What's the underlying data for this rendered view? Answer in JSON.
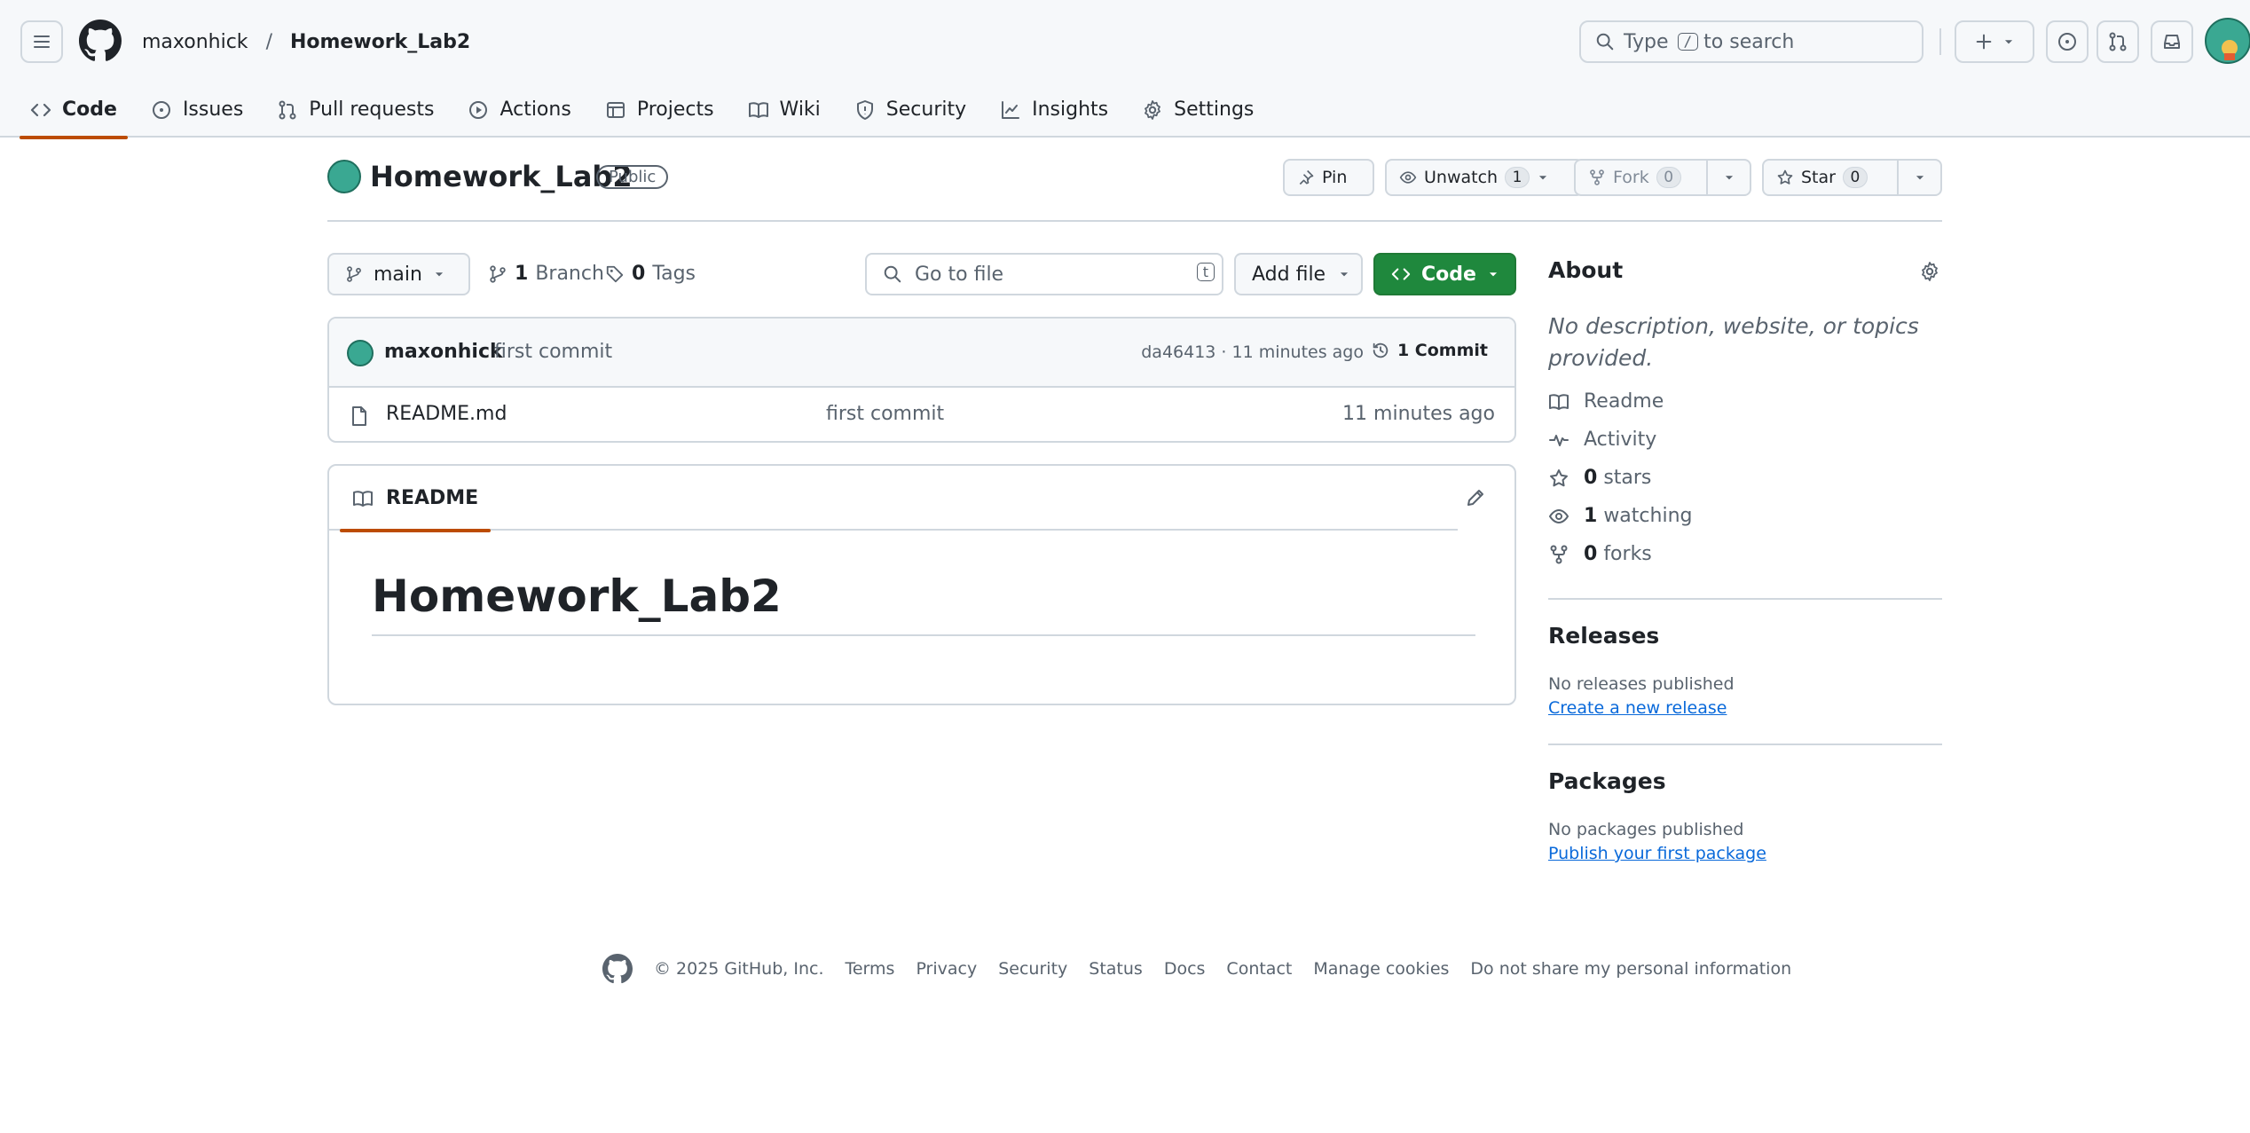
{
  "colors": {
    "accent": "#bc4c00",
    "primary_green": "#1f883d",
    "link": "#0969da",
    "border": "#d0d7de",
    "muted": "#59636e"
  },
  "header": {
    "owner": "maxonhick",
    "separator": "/",
    "repo": "Homework_Lab2",
    "search": {
      "prefix": "Type",
      "key": "/",
      "suffix": "to search"
    },
    "icons": [
      "hamburger-icon",
      "github-logo-icon",
      "plus-icon",
      "issues-icon",
      "pull-request-icon",
      "inbox-icon"
    ]
  },
  "tabs": [
    {
      "label": "Code",
      "icon": "code-icon",
      "active": true
    },
    {
      "label": "Issues",
      "icon": "issue-icon"
    },
    {
      "label": "Pull requests",
      "icon": "pull-request-icon"
    },
    {
      "label": "Actions",
      "icon": "play-icon"
    },
    {
      "label": "Projects",
      "icon": "table-icon"
    },
    {
      "label": "Wiki",
      "icon": "book-icon"
    },
    {
      "label": "Security",
      "icon": "shield-icon"
    },
    {
      "label": "Insights",
      "icon": "graph-icon"
    },
    {
      "label": "Settings",
      "icon": "gear-icon"
    }
  ],
  "repo": {
    "name": "Homework_Lab2",
    "visibility": "Public",
    "actions": {
      "pin": "Pin",
      "unwatch": "Unwatch",
      "watch_count": "1",
      "fork": "Fork",
      "fork_count": "0",
      "star": "Star",
      "star_count": "0"
    }
  },
  "filenav": {
    "branch": "main",
    "branches_count": "1",
    "branches_label": "Branch",
    "tags_count": "0",
    "tags_label": "Tags",
    "goto_placeholder": "Go to file",
    "goto_key": "t",
    "add_file": "Add file",
    "code": "Code"
  },
  "commit": {
    "author": "maxonhick",
    "message": "first commit",
    "hash_time": "da46413 · 11 minutes ago",
    "count_label": "1 Commit"
  },
  "files": [
    {
      "name": "README.md",
      "message": "first commit",
      "time": "11 minutes ago"
    }
  ],
  "readme": {
    "tab": "README",
    "title": "Homework_Lab2"
  },
  "about": {
    "title": "About",
    "description": "No description, website, or topics provided.",
    "items": [
      {
        "icon": "book-icon",
        "count": "",
        "label": "Readme"
      },
      {
        "icon": "pulse-icon",
        "count": "",
        "label": "Activity"
      },
      {
        "icon": "star-icon",
        "count": "0",
        "label": "stars"
      },
      {
        "icon": "eye-icon",
        "count": "1",
        "label": "watching"
      },
      {
        "icon": "fork-icon",
        "count": "0",
        "label": "forks"
      }
    ]
  },
  "releases": {
    "title": "Releases",
    "empty": "No releases published",
    "link": "Create a new release"
  },
  "packages": {
    "title": "Packages",
    "empty": "No packages published",
    "link": "Publish your first package"
  },
  "footer": {
    "copyright": "© 2025 GitHub, Inc.",
    "links": [
      "Terms",
      "Privacy",
      "Security",
      "Status",
      "Docs",
      "Contact",
      "Manage cookies",
      "Do not share my personal information"
    ]
  }
}
